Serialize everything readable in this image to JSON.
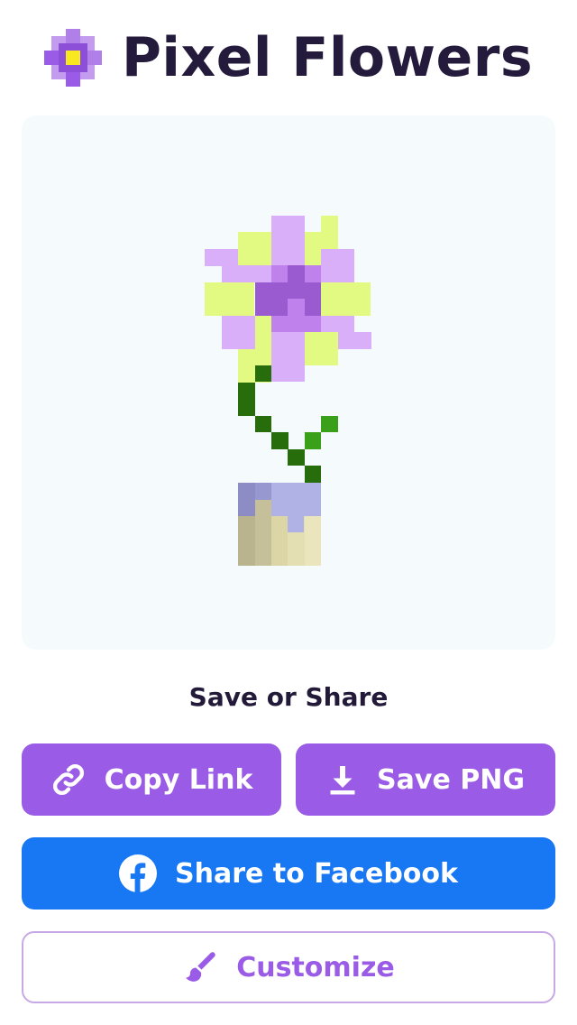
{
  "app": {
    "title": "Pixel Flowers",
    "logo_icon": "pixel-flower-logo-icon"
  },
  "share": {
    "heading": "Save or Share",
    "copy_link_label": "Copy Link",
    "copy_link_icon": "link-icon",
    "save_png_label": "Save PNG",
    "save_png_icon": "download-icon",
    "facebook_label": "Share to Facebook",
    "facebook_icon": "facebook-icon",
    "customize_label": "Customize",
    "customize_icon": "paintbrush-icon"
  },
  "colors": {
    "title_text": "#241a3b",
    "accent_purple": "#9a5be6",
    "facebook_blue": "#1877f2",
    "canvas_bg": "#f5fbfd",
    "petal_light": "#d8aff8",
    "petal_mid": "#bf82ec",
    "center_dark": "#9a5bd0",
    "leaf_yellow": "#e2fa82",
    "stem_green": "#276d0c",
    "leaf_green": "#3aa01a",
    "pot_lavender": "#b0b2e6",
    "pot_beige": "#e2dcaa"
  }
}
